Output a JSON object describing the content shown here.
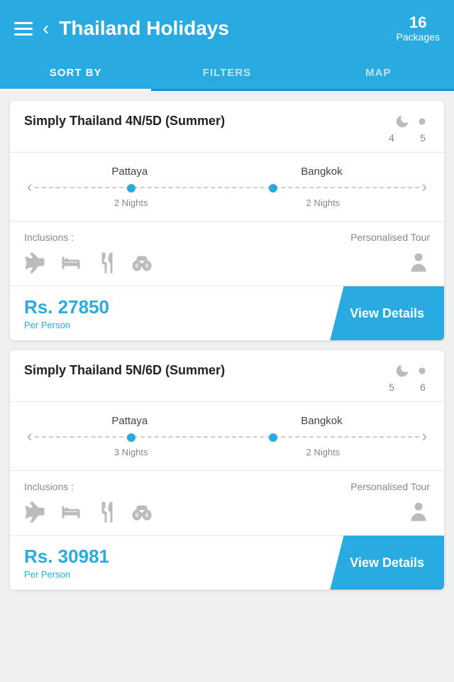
{
  "header": {
    "title": "Thailand Holidays",
    "packages_count": "16",
    "packages_label": "Packages"
  },
  "tabs": [
    {
      "id": "sort",
      "label": "SORT BY",
      "active": true
    },
    {
      "id": "filters",
      "label": "FILTERS",
      "active": false
    },
    {
      "id": "map",
      "label": "MAP",
      "active": false
    }
  ],
  "packages": [
    {
      "id": 1,
      "title": "Simply Thailand 4N/5D (Summer)",
      "nights": 4,
      "days": 5,
      "cities": [
        "Pattaya",
        "Bangkok"
      ],
      "city_nights": [
        "2 Nights",
        "2 Nights"
      ],
      "inclusions_label": "Inclusions :",
      "personalised_label": "Personalised Tour",
      "price": "Rs. 27850",
      "per_person": "Per Person",
      "view_details": "View Details"
    },
    {
      "id": 2,
      "title": "Simply Thailand 5N/6D (Summer)",
      "nights": 5,
      "days": 6,
      "cities": [
        "Pattaya",
        "Bangkok"
      ],
      "city_nights": [
        "3 Nights",
        "2 Nights"
      ],
      "inclusions_label": "Inclusions :",
      "personalised_label": "Personalised Tour",
      "price": "Rs. 30981",
      "per_person": "Per Person",
      "view_details": "View Details"
    }
  ]
}
